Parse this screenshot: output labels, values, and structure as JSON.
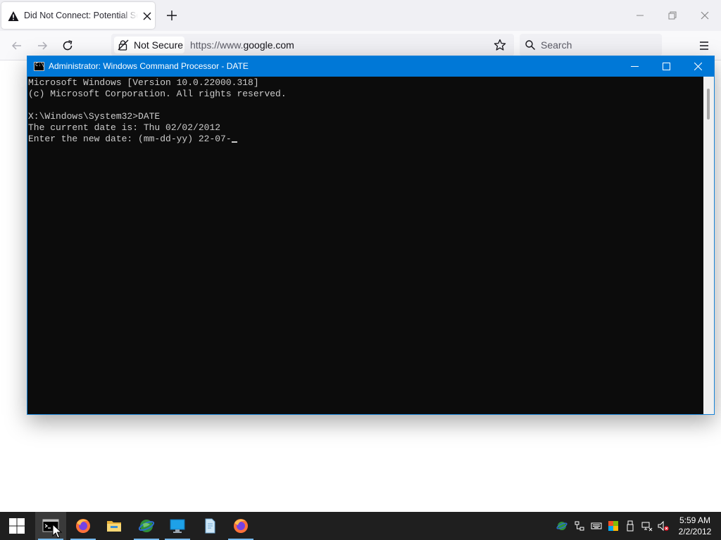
{
  "browser": {
    "tab": {
      "title": "Did Not Connect: Potential Security Issue",
      "warning_icon": "warning-triangle-icon",
      "close_icon": "close-icon"
    },
    "new_tab_icon": "plus-icon",
    "window_controls": [
      "minimize-icon",
      "restore-icon",
      "close-icon"
    ],
    "nav": {
      "back_icon": "arrow-left-icon",
      "forward_icon": "arrow-right-icon",
      "reload_icon": "reload-icon",
      "security_label": "Not Secure",
      "url_prefix": "https://www.",
      "url_domain": "google.com",
      "bookmark_icon": "star-icon",
      "search_placeholder": "Search",
      "menu_icon": "hamburger-menu-icon"
    }
  },
  "cmd": {
    "title": "Administrator: Windows Command Processor - DATE",
    "icon_label": "C:\\",
    "lines": [
      "Microsoft Windows [Version 10.0.22000.318]",
      "(c) Microsoft Corporation. All rights reserved.",
      "",
      "X:\\Windows\\System32>DATE",
      "The current date is: Thu 02/02/2012",
      "Enter the new date: (mm-dd-yy) 22-07-"
    ]
  },
  "taskbar": {
    "apps": [
      "windows-start-icon",
      "command-prompt-icon",
      "firefox-icon",
      "file-explorer-icon",
      "network-globe-icon",
      "monitor-icon",
      "document-icon",
      "firefox-icon"
    ],
    "tray": [
      "network-globe-icon",
      "network-share-icon",
      "keyboard-icon",
      "color-flag-icon",
      "usb-icon",
      "network-disconnected-icon",
      "volume-muted-icon"
    ],
    "time": "5:59 AM",
    "date": "2/2/2012"
  },
  "colors": {
    "cmd_titlebar": "#0078d7",
    "console_bg": "#0c0c0c",
    "console_text": "#cccccc",
    "taskbar_bg": "#1f1f1f"
  }
}
